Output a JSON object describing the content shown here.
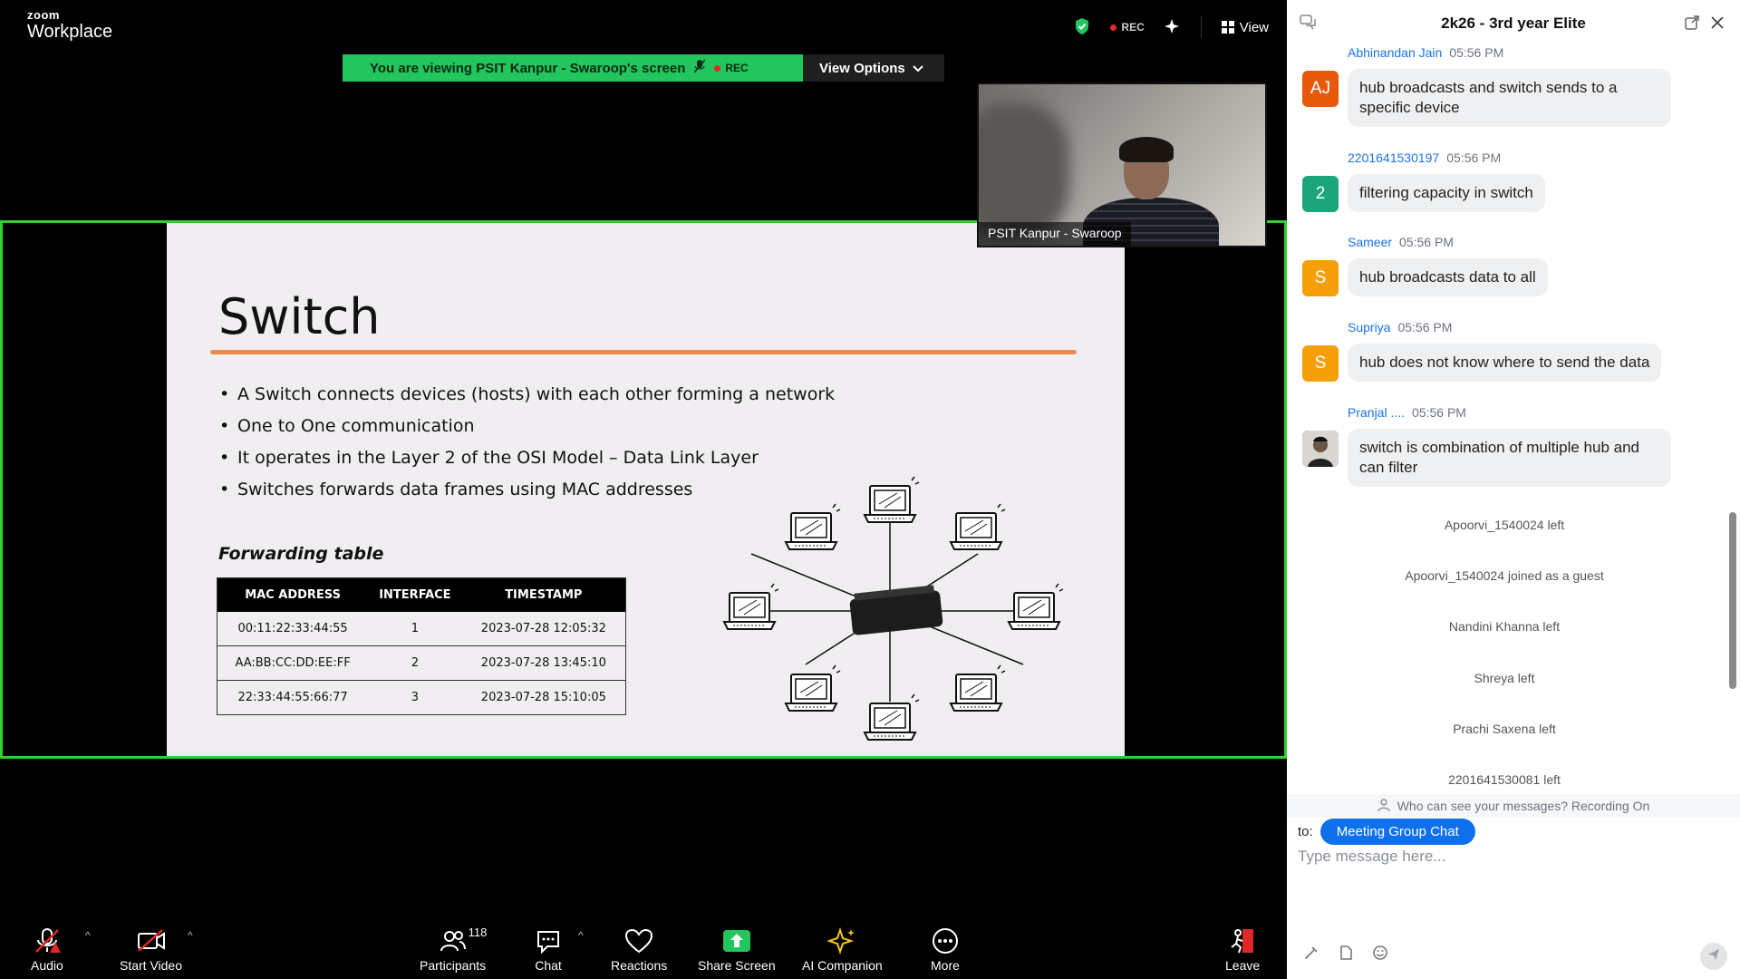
{
  "app": {
    "brand_top": "zoom",
    "brand_bottom": "Workplace",
    "rec_label": "REC",
    "view_label": "View"
  },
  "banner": {
    "viewing_text": "You are viewing  PSIT Kanpur - Swaroop's screen",
    "rec_label": "REC",
    "view_options": "View Options"
  },
  "slide": {
    "title": "Switch",
    "bullets": [
      "A Switch connects devices (hosts) with each other forming a network",
      "One to One communication",
      "It operates in the Layer 2 of the OSI Model – Data Link Layer",
      "Switches forwards data frames using MAC addresses"
    ],
    "table_title": "Forwarding table",
    "table": {
      "headers": [
        "MAC ADDRESS",
        "INTERFACE",
        "TIMESTAMP"
      ],
      "rows": [
        [
          "00:11:22:33:44:55",
          "1",
          "2023-07-28 12:05:32"
        ],
        [
          "AA:BB:CC:DD:EE:FF",
          "2",
          "2023-07-28 13:45:10"
        ],
        [
          "22:33:44:55:66:77",
          "3",
          "2023-07-28 15:10:05"
        ]
      ]
    }
  },
  "video": {
    "name": "PSIT Kanpur - Swaroop"
  },
  "toolbar": {
    "audio": "Audio",
    "start_video": "Start Video",
    "participants": "Participants",
    "participants_count": "118",
    "chat": "Chat",
    "reactions": "Reactions",
    "share_screen": "Share Screen",
    "ai_companion": "AI Companion",
    "more": "More",
    "leave": "Leave"
  },
  "chat": {
    "title": "2k26 - 3rd year Elite",
    "messages": [
      {
        "name": "Abhinandan Jain",
        "time": "05:56 PM",
        "initials": "AJ",
        "color": "#e8590c",
        "lines": [
          "hub broadcasts and switch sends to a",
          "specific device"
        ]
      },
      {
        "name": "2201641530197",
        "time": "05:56 PM",
        "initials": "2",
        "color": "#1ba57a",
        "lines": [
          "filtering capacity in switch"
        ]
      },
      {
        "name": "Sameer",
        "time": "05:56 PM",
        "initials": "S",
        "color": "#f59f0a",
        "lines": [
          "hub broadcasts data to all"
        ]
      },
      {
        "name": "Supriya",
        "time": "05:56 PM",
        "initials": "S",
        "color": "#f59f0a",
        "lines": [
          "hub does not know where to send the data"
        ]
      },
      {
        "name": "Pranjal ....",
        "time": "05:56 PM",
        "initials": "",
        "color": "#333333",
        "lines": [
          "switch is combination of multiple hub and",
          "can filter"
        ]
      }
    ],
    "system": [
      "Apoorvi_1540024 left",
      "Apoorvi_1540024 joined as a guest",
      "Nandini Khanna left",
      "Shreya left",
      "Prachi Saxena left",
      "2201641530081 left"
    ],
    "who_can_see": "Who can see your messages? Recording On",
    "to_label": "to:",
    "to_target": "Meeting Group Chat",
    "placeholder": "Type message here..."
  },
  "colors": {
    "share_border": "#2fd02f",
    "banner_green": "#23c55e",
    "accent_blue": "#0e71eb",
    "slide_underline": "#f08a4b"
  }
}
